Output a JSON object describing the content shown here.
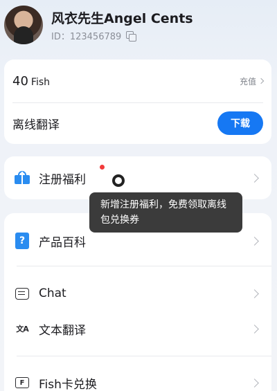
{
  "profile": {
    "name": "风衣先生Angel Cents",
    "id_text": "ID：123456789"
  },
  "balance": {
    "amount": "40",
    "unit": "Fish",
    "recharge_label": "充值"
  },
  "offline": {
    "label": "离线翻译",
    "download_label": "下载"
  },
  "welfare": {
    "label": "注册福利",
    "tooltip": "新增注册福利，免费领取离线包兑换券"
  },
  "menu": {
    "items": [
      {
        "label": "产品百科",
        "icon": "question-doc-icon"
      },
      {
        "label": "Chat",
        "icon": "chat-icon"
      },
      {
        "label": "文本翻译",
        "icon": "translate-icon"
      },
      {
        "label": "Fish卡兑换",
        "icon": "card-f-icon"
      }
    ]
  },
  "colors": {
    "accent": "#1678f3",
    "icon_blue": "#2a8cf0",
    "badge_red": "#f23b3b",
    "tooltip_bg": "#3b3b3b"
  }
}
